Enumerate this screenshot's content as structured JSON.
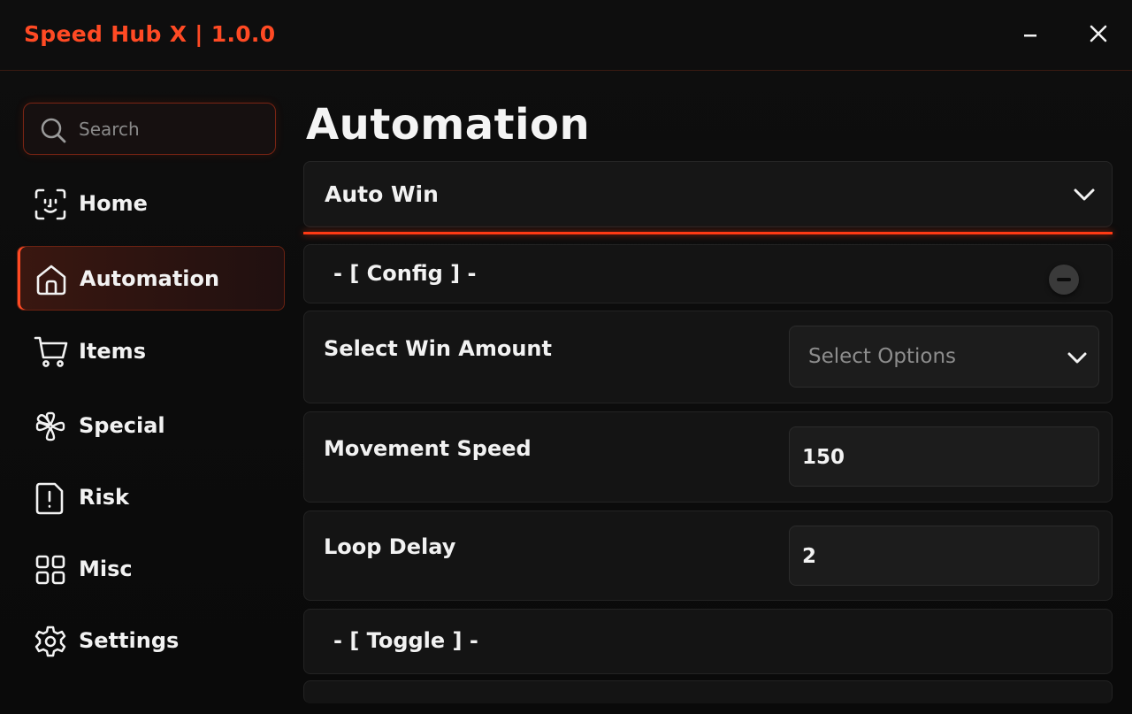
{
  "app": {
    "title": "Speed Hub X | 1.0.0",
    "minimize_label": "–",
    "close_label": "X",
    "accent_color": "#ff4a24"
  },
  "search": {
    "placeholder": "Search",
    "icon": "search-icon"
  },
  "sidebar": {
    "items": [
      {
        "label": "Home",
        "icon": "face-scan-icon",
        "active": false
      },
      {
        "label": "Automation",
        "icon": "home-icon",
        "active": true
      },
      {
        "label": "Items",
        "icon": "cart-icon",
        "active": false
      },
      {
        "label": "Special",
        "icon": "clover-icon",
        "active": false
      },
      {
        "label": "Risk",
        "icon": "file-alert-icon",
        "active": false
      },
      {
        "label": "Misc",
        "icon": "grid-icon",
        "active": false
      },
      {
        "label": "Settings",
        "icon": "gear-icon",
        "active": false
      }
    ]
  },
  "main": {
    "title": "Automation",
    "section": {
      "label": "Auto Win",
      "icon": "chevron-down-icon"
    },
    "config_header": "- [ Config ] -",
    "win_amount": {
      "label": "Select Win Amount",
      "value": "Select Options"
    },
    "movement_speed": {
      "label": "Movement Speed",
      "value": "150"
    },
    "loop_delay": {
      "label": "Loop Delay",
      "value": "2"
    },
    "toggle_header": "- [ Toggle ] -"
  }
}
